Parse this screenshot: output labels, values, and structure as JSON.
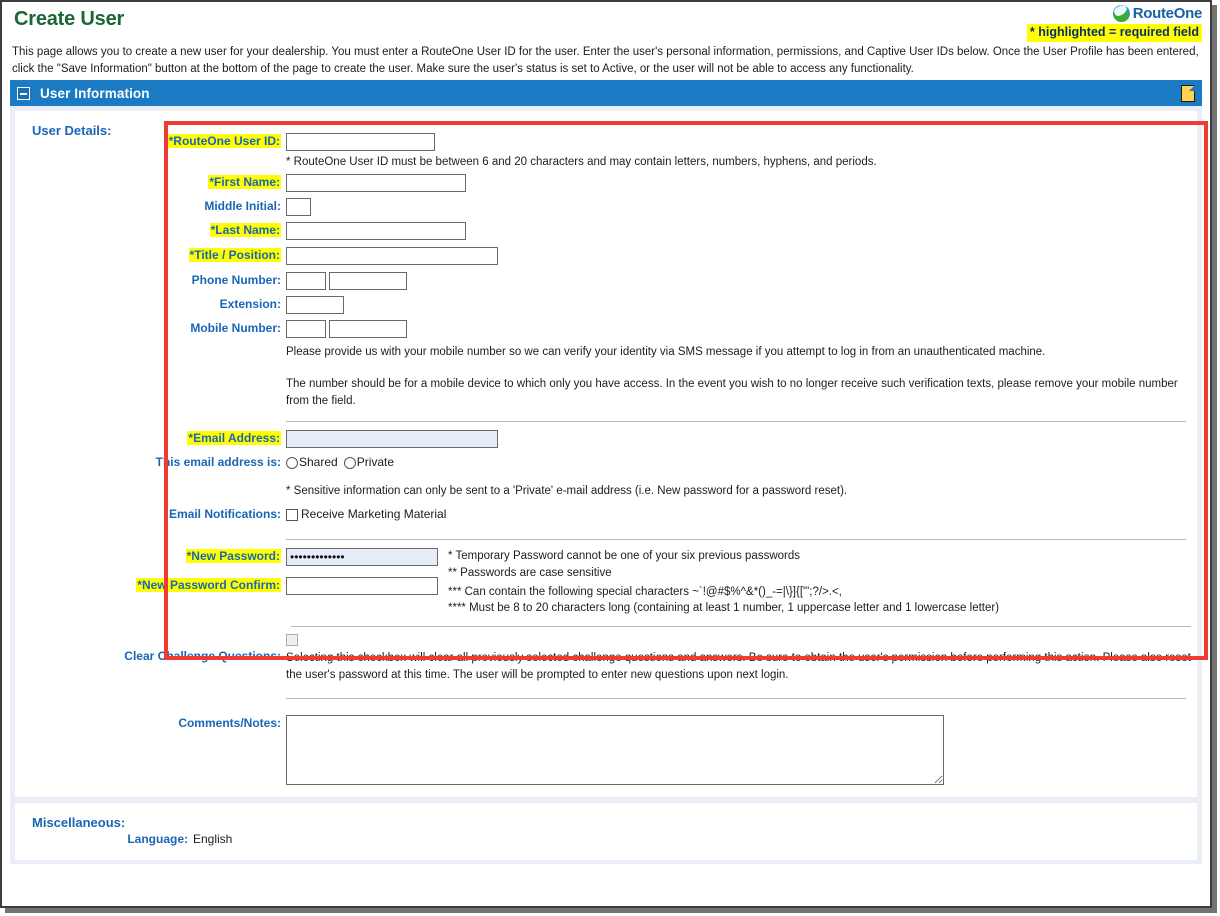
{
  "header": {
    "page_title": "Create User",
    "brand_name": "RouteOne",
    "brand_icon": "routeone-swoosh-logo-icon",
    "required_note": "* highlighted = required field",
    "description": "This page allows you to create a new user for your dealership. You must enter a RouteOne User ID for the user. Enter the user's personal information, permissions, and Captive User IDs below. Once the User Profile has been entered, click the \"Save Information\" button at the bottom of the page to create the user. Make sure the user's status is set to Active, or the user will not be able to access any functionality."
  },
  "section": {
    "title": "User Information",
    "collapse_icon": "collapse-minus-icon",
    "note_icon": "note-page-icon"
  },
  "user_details": {
    "group_label": "User Details:",
    "fields": {
      "user_id": {
        "label": "*RouteOne User ID:",
        "required": true,
        "value": "",
        "hint": "* RouteOne User ID must be between 6 and 20 characters and may contain letters, numbers, hyphens, and periods."
      },
      "first_name": {
        "label": "*First Name:",
        "required": true,
        "value": ""
      },
      "middle_initial": {
        "label": "Middle Initial:",
        "required": false,
        "value": ""
      },
      "last_name": {
        "label": "*Last Name:",
        "required": true,
        "value": ""
      },
      "title_position": {
        "label": "*Title / Position:",
        "required": true,
        "value": ""
      },
      "phone_number": {
        "label": "Phone Number:",
        "required": false,
        "area_value": "",
        "number_value": ""
      },
      "extension": {
        "label": "Extension:",
        "required": false,
        "value": ""
      },
      "mobile_number": {
        "label": "Mobile Number:",
        "required": false,
        "area_value": "",
        "number_value": ""
      },
      "email": {
        "label": "*Email Address:",
        "required": true,
        "value": ""
      },
      "email_type": {
        "label": "This email address is:",
        "options": [
          "Shared",
          "Private"
        ],
        "selected": ""
      },
      "email_notifications": {
        "label": "Email Notifications:",
        "checkbox_label": "Receive Marketing Material",
        "checked": false
      },
      "new_password": {
        "label": "*New Password:",
        "required": true,
        "value": "•••••••••••••"
      },
      "new_password_confirm": {
        "label": "*New Password Confirm:",
        "required": true,
        "value": ""
      },
      "clear_challenge": {
        "label": "Clear Challenge Questions:",
        "checked": false
      },
      "comments": {
        "label": "Comments/Notes:",
        "value": ""
      }
    },
    "mobile_note_1": "Please provide us with your mobile number so we can verify your identity via SMS message if you attempt to log in from an unauthenticated machine.",
    "mobile_note_2": "The number should be for a mobile device to which only you have access. In the event you wish to no longer receive such verification texts, please remove your mobile number from the field.",
    "email_sensitive_note": "* Sensitive information can only be sent to a 'Private' e-mail address (i.e. New password for a password reset).",
    "password_notes": [
      "* Temporary Password cannot be one of your six previous passwords",
      "** Passwords are case sensitive",
      "*** Can contain the following special characters ~`!@#$%^&*()_-=|\\}]{[\"';?/>.<,",
      "**** Must be 8 to 20 characters long (containing at least 1 number, 1 uppercase letter and 1 lowercase letter)"
    ],
    "clear_challenge_note": "Selecting this checkbox will clear all previously selected challenge questions and answers. Be sure to obtain the user's permission before performing this action. Please also reset the user's password at this time. The user will be prompted to enter new questions upon next login."
  },
  "miscellaneous": {
    "group_label": "Miscellaneous:",
    "language_label": "Language:",
    "language_value": "English"
  },
  "colors": {
    "title_green": "#1a6636",
    "label_blue": "#1a66b5",
    "bar_blue": "#1a7bc4",
    "highlight_yellow": "#ffff00",
    "annotation_red": "#ee3b33",
    "panel_bg": "#eaeef6"
  }
}
